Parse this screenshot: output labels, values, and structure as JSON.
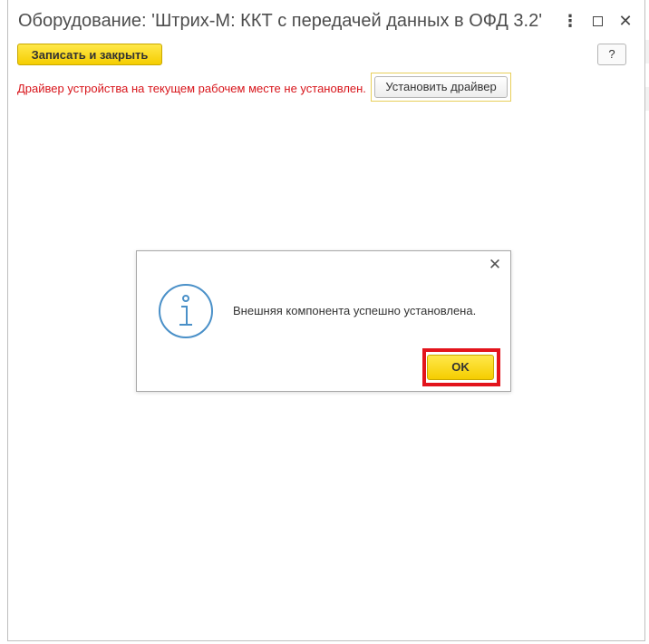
{
  "window": {
    "title": "Оборудование: 'Штрих-М: ККТ с передачей данных в ОФД 3.2' н...",
    "more_icon": "more-icon",
    "maximize_icon": "maximize-icon",
    "close_icon": "close-icon",
    "close_glyph": "✕"
  },
  "toolbar": {
    "save_close_label": "Записать и закрыть",
    "help_label": "?"
  },
  "driver": {
    "warning_text": "Драйвер устройства на текущем рабочем месте не установлен.",
    "install_label": "Установить драйвер"
  },
  "dialog": {
    "close_glyph": "✕",
    "icon": "info-icon",
    "message": "Внешняя компонента успешно установлена.",
    "ok_label": "OK"
  },
  "colors": {
    "accent_yellow": "#f5cd00",
    "warning_red": "#d8151b",
    "highlight_red": "#e3141c",
    "info_blue": "#4a90c8"
  }
}
